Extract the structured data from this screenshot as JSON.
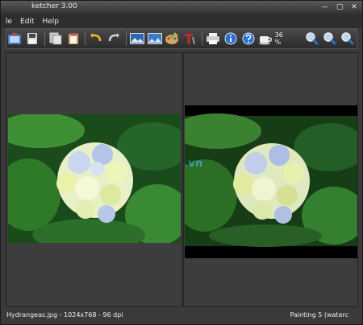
{
  "window": {
    "title": "ketcher 3.00",
    "min_glyph": "—",
    "max_glyph": "▢",
    "close_glyph": "✕"
  },
  "menu": {
    "items": [
      {
        "label": "le"
      },
      {
        "label": "Edit"
      },
      {
        "label": "Help"
      }
    ]
  },
  "toolbar": {
    "zoom": "36 %",
    "icons": [
      "open-icon",
      "save-icon",
      "copy-icon",
      "paste-icon",
      "undo-icon",
      "redo-icon",
      "image-icon",
      "image-alt-icon",
      "palette-icon",
      "text-icon",
      "print-icon",
      "info-icon",
      "help-icon",
      "coffee-icon",
      "zoom-in-icon",
      "zoom-fit-icon",
      "zoom-out-icon"
    ]
  },
  "status": {
    "left": "Hydrangeas.jpg - 1024x768 - 96 dpi",
    "right": "Painting 5 (waterc"
  },
  "watermark": "LOG.vn",
  "colors": {
    "accent_blue": "#2a6fd0",
    "background": "#3d3d3d"
  }
}
